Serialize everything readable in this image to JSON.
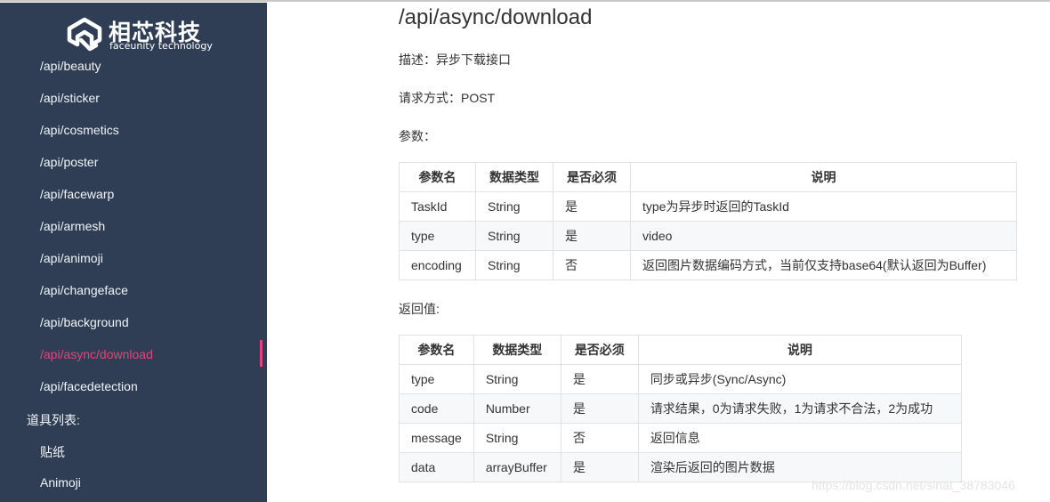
{
  "brand": {
    "name": "相芯科技",
    "tagline": "faceunity technology"
  },
  "sidebar": {
    "items": [
      {
        "label": "/api/beauty"
      },
      {
        "label": "/api/sticker"
      },
      {
        "label": "/api/cosmetics"
      },
      {
        "label": "/api/poster"
      },
      {
        "label": "/api/facewarp"
      },
      {
        "label": "/api/armesh"
      },
      {
        "label": "/api/animoji"
      },
      {
        "label": "/api/changeface"
      },
      {
        "label": "/api/background"
      },
      {
        "label": "/api/async/download",
        "active": true
      },
      {
        "label": "/api/facedetection"
      }
    ],
    "group_label": "道具列表:",
    "sub_items": [
      {
        "label": "贴纸"
      },
      {
        "label": "Animoji"
      }
    ],
    "active_color": "#e0457b",
    "background_color": "#2f3e55"
  },
  "main": {
    "title": "/api/async/download",
    "description": "描述：异步下载接口",
    "method": "请求方式：POST",
    "params_label": "参数：",
    "params_table": {
      "headers": [
        "参数名",
        "数据类型",
        "是否必须",
        "说明"
      ],
      "rows": [
        [
          "TaskId",
          "String",
          "是",
          "type为异步时返回的TaskId"
        ],
        [
          "type",
          "String",
          "是",
          "video"
        ],
        [
          "encoding",
          "String",
          "否",
          "返回图片数据编码方式，当前仅支持base64(默认返回为Buffer)"
        ]
      ]
    },
    "return_label": "返回值:",
    "return_table": {
      "headers": [
        "参数名",
        "数据类型",
        "是否必须",
        "说明"
      ],
      "rows": [
        [
          "type",
          "String",
          "是",
          "同步或异步(Sync/Async)"
        ],
        [
          "code",
          "Number",
          "是",
          "请求结果，0为请求失败，1为请求不合法，2为成功"
        ],
        [
          "message",
          "String",
          "否",
          "返回信息"
        ],
        [
          "data",
          "arrayBuffer",
          "是",
          "渲染后返回的图片数据"
        ]
      ]
    }
  },
  "watermark": "https://blog.csdn.net/sinat_38783046"
}
